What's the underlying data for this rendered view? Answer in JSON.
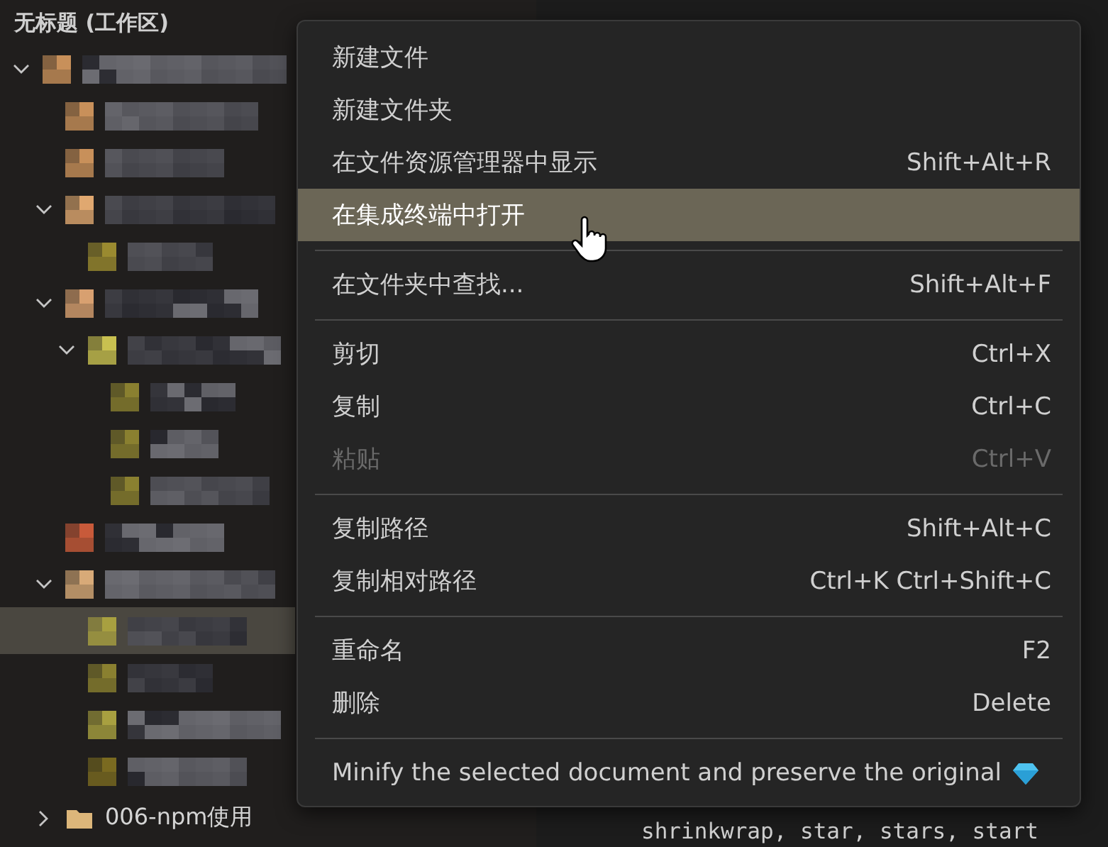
{
  "explorer": {
    "title": "无标题 (工作区)",
    "tree": [
      {
        "kind": "redacted",
        "expanded": true,
        "selected": false,
        "color": "#c8905a",
        "children": [
          {
            "kind": "redacted",
            "selected": false,
            "color": "#c8905a"
          },
          {
            "kind": "redacted",
            "selected": false,
            "color": "#c8905a"
          },
          {
            "kind": "redacted",
            "expanded": true,
            "selected": false,
            "color": "#e0a870",
            "children": [
              {
                "kind": "redacted",
                "selected": false,
                "color": "#9a8a30"
              }
            ]
          },
          {
            "kind": "redacted",
            "expanded": true,
            "selected": false,
            "color": "#d8a070",
            "children": [
              {
                "kind": "redacted",
                "expanded": true,
                "selected": false,
                "color": "#c8c050",
                "children": [
                  {
                    "kind": "redacted",
                    "selected": false,
                    "color": "#8a8030"
                  },
                  {
                    "kind": "redacted",
                    "selected": false,
                    "color": "#8a8030"
                  },
                  {
                    "kind": "redacted",
                    "selected": false,
                    "color": "#8a8030"
                  }
                ]
              }
            ]
          },
          {
            "kind": "redacted",
            "selected": false,
            "color": "#c85a3a"
          },
          {
            "kind": "redacted",
            "expanded": true,
            "selected": false,
            "color": "#d8aa78",
            "children": [
              {
                "kind": "redacted",
                "selected": true,
                "color": "#a8a040"
              },
              {
                "kind": "redacted",
                "selected": false,
                "color": "#8a8030"
              },
              {
                "kind": "redacted",
                "selected": false,
                "color": "#a8a040"
              },
              {
                "kind": "redacted",
                "selected": false,
                "color": "#7a6a20"
              }
            ]
          },
          {
            "kind": "folder",
            "label": "006-npm使用",
            "expanded": false,
            "selected": false,
            "color": "#dcb67a"
          }
        ]
      }
    ]
  },
  "editor": {
    "code_line": "shrinkwrap, star, stars, start"
  },
  "context_menu": {
    "groups": [
      [
        {
          "label": "新建文件",
          "disabled": false,
          "selected": false
        },
        {
          "label": "新建文件夹",
          "disabled": false,
          "selected": false
        },
        {
          "label": "在文件资源管理器中显示",
          "shortcut": "Shift+Alt+R",
          "disabled": false,
          "selected": false
        },
        {
          "label": "在集成终端中打开",
          "disabled": false,
          "selected": true
        }
      ],
      [
        {
          "label": "在文件夹中查找...",
          "shortcut": "Shift+Alt+F",
          "disabled": false,
          "selected": false
        }
      ],
      [
        {
          "label": "剪切",
          "shortcut": "Ctrl+X",
          "disabled": false,
          "selected": false
        },
        {
          "label": "复制",
          "shortcut": "Ctrl+C",
          "disabled": false,
          "selected": false
        },
        {
          "label": "粘贴",
          "shortcut": "Ctrl+V",
          "disabled": true,
          "selected": false
        }
      ],
      [
        {
          "label": "复制路径",
          "shortcut": "Shift+Alt+C",
          "disabled": false,
          "selected": false
        },
        {
          "label": "复制相对路径",
          "shortcut": "Ctrl+K Ctrl+Shift+C",
          "disabled": false,
          "selected": false
        }
      ],
      [
        {
          "label": "重命名",
          "shortcut": "F2",
          "disabled": false,
          "selected": false
        },
        {
          "label": "删除",
          "shortcut": "Delete",
          "disabled": false,
          "selected": false
        }
      ],
      [
        {
          "label": "Minify the selected document and preserve the original",
          "kind": "extension",
          "disabled": false,
          "selected": false
        }
      ]
    ]
  }
}
